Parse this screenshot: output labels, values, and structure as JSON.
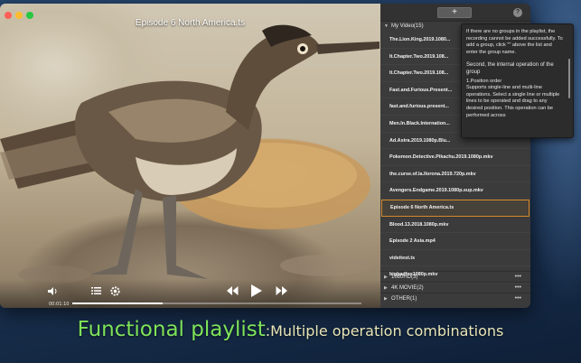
{
  "colors": {
    "caption_main": "#7ee35a",
    "caption_sub": "#e9e6b8",
    "active_item_border": "#d28a2a",
    "panel_bg": "#3b3b3b"
  },
  "player": {
    "title": "Episode 6 North America.ts",
    "time_elapsed": "00:01:10",
    "controls": {
      "volume_icon": "speaker-icon",
      "playlist_icon": "list-icon",
      "settings_icon": "gear-icon",
      "prev_icon": "rewind-icon",
      "play_icon": "play-icon",
      "next_icon": "fast-forward-icon"
    }
  },
  "playlist": {
    "add_label": "+",
    "help_label": "?",
    "group": {
      "name": "My Video(15)",
      "items": [
        "The.Lion.King.2019.1080...",
        "It.Chapter.Two.2019.108...",
        "It.Chapter.Two.2019.108...",
        "Fast.and.Furious.Present...",
        "fast.and.furious.present...",
        "Men.In.Black.Internation...",
        "Ad.Astra.2019.1080p.Blu...",
        "Pokemon.Detective.Pikachu.2019.1080p.mkv",
        "the.curse.of.la.llorona.2019.720p.mkv",
        "Avengers.Endgame.2019.1080p.sup.mkv",
        "Episode 6 North America.ts",
        "Blood.13.2018.1080p.mkv",
        "Episode 2 Asia.mp4",
        "videitest.ts",
        "bigbadfox1080p.mkv"
      ],
      "active_index": 10
    },
    "collapsed_groups": [
      {
        "name": "1080HD(3)",
        "more": "•••"
      },
      {
        "name": "4K MOVIE(2)",
        "more": "•••"
      },
      {
        "name": "OTHER(1)",
        "more": "•••"
      }
    ]
  },
  "tooltip": {
    "intro": "If there are no groups in the playlist, the recording cannot be added successfully. To add a group, click \"\" above the list and enter the group name.",
    "heading": "Second, the internal operation of the group",
    "subheading": "1.Position order",
    "body": "Supports single-line and multi-line operations. Select a single line or multiple lines to be operated and drag to any desired position. This operation can be performed across"
  },
  "caption": {
    "main": "Functional playlist",
    "sub": ":Multiple operation combinations"
  }
}
